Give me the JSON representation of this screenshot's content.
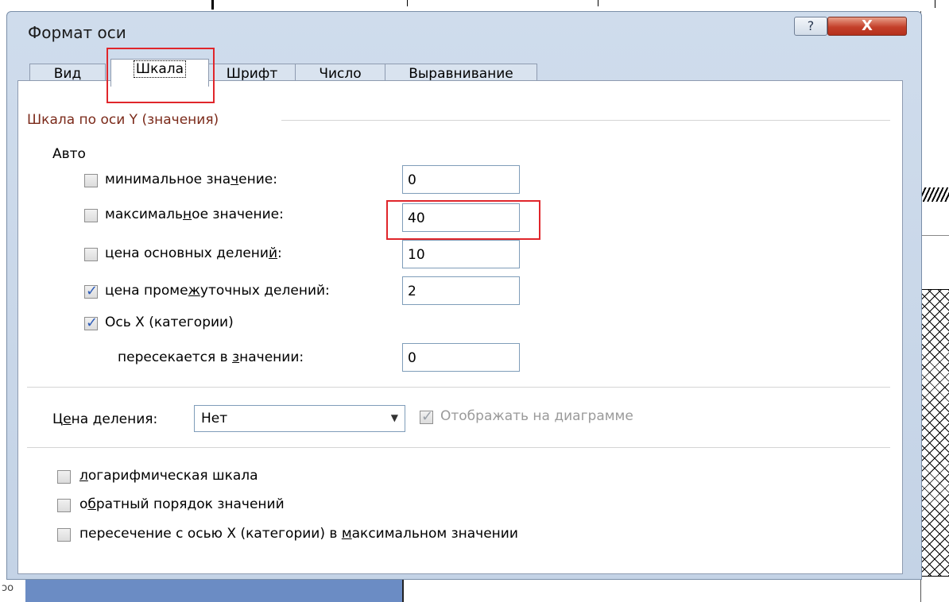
{
  "dialog": {
    "title": "Формат оси",
    "help_symbol": "?",
    "close_symbol": "X"
  },
  "tabs": [
    {
      "label": "Вид"
    },
    {
      "label": "Шкала"
    },
    {
      "label": "Шрифт"
    },
    {
      "label": "Число"
    },
    {
      "label": "Выравнивание"
    }
  ],
  "active_tab": "Шкала",
  "scale": {
    "group_title": "Шкала по оси Y (значения)",
    "auto_label": "Авто",
    "min": {
      "label_pre": "минимальное зна",
      "label_u": "ч",
      "label_post": "ение:",
      "checked": false,
      "value": "0"
    },
    "max": {
      "label_pre": "максималь",
      "label_u": "н",
      "label_post": "ое значение:",
      "checked": false,
      "value": "40"
    },
    "major": {
      "label_pre": "цена основных делени",
      "label_u": "й",
      "label_post": ":",
      "checked": false,
      "value": "10"
    },
    "minor": {
      "label_pre": "цена проме",
      "label_u": "ж",
      "label_post": "уточных делений:",
      "checked": true,
      "value": "2"
    },
    "x_axis": {
      "label": "Ось X (категории)",
      "checked": true
    },
    "crosses": {
      "label_pre": "пересекается в ",
      "label_u": "з",
      "label_post": "начении:",
      "value": "0"
    }
  },
  "display_units": {
    "label_pre": "Ц",
    "label_u": "е",
    "label_post": "на деления:",
    "selected": "Нет",
    "show_on_chart_label": "Отображать на диаграмме",
    "show_on_chart_checked": true
  },
  "options": {
    "log": {
      "label_u": "л",
      "label_post": "огарифмическая шкала",
      "checked": false
    },
    "reverse": {
      "label_pre": "о",
      "label_u": "б",
      "label_post": "ратный порядок значений",
      "checked": false
    },
    "cross_max": {
      "label_pre": "пересечение с осью X (категории) в ",
      "label_u": "м",
      "label_post": "аксимальном значении",
      "checked": false
    }
  },
  "background": {
    "bottom_left_text": "ɔo"
  },
  "colors": {
    "highlight": "#e0262b",
    "group_title": "#7b2a1a",
    "check": "#2e5cb8"
  }
}
